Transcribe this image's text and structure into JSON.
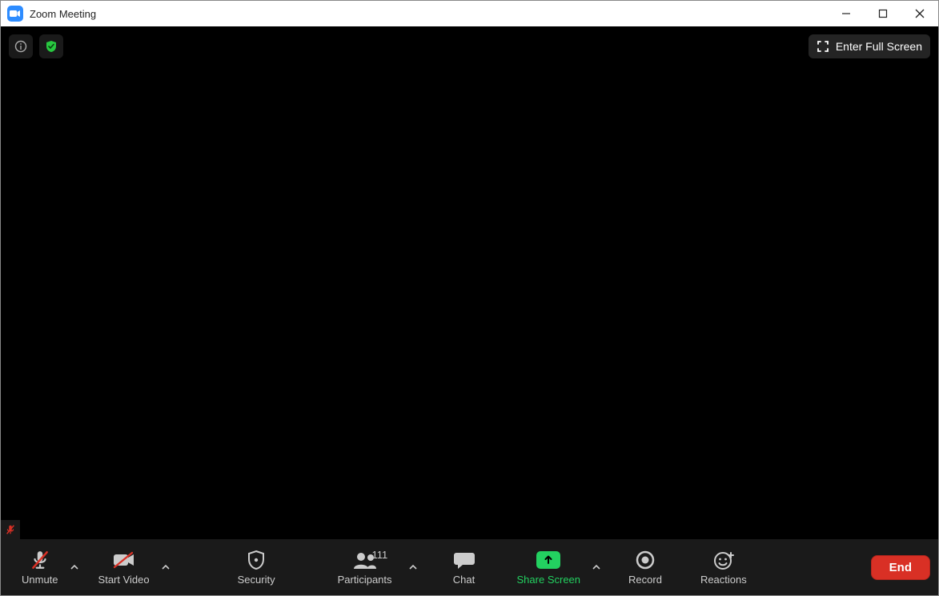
{
  "window": {
    "title": "Zoom Meeting"
  },
  "overlay": {
    "fullscreen_label": "Enter Full Screen"
  },
  "toolbar": {
    "unmute": {
      "label": "Unmute"
    },
    "start_video": {
      "label": "Start Video"
    },
    "security": {
      "label": "Security"
    },
    "participants": {
      "label": "Participants",
      "count": "111"
    },
    "chat": {
      "label": "Chat"
    },
    "share_screen": {
      "label": "Share Screen"
    },
    "record": {
      "label": "Record"
    },
    "reactions": {
      "label": "Reactions"
    },
    "end": {
      "label": "End"
    }
  }
}
